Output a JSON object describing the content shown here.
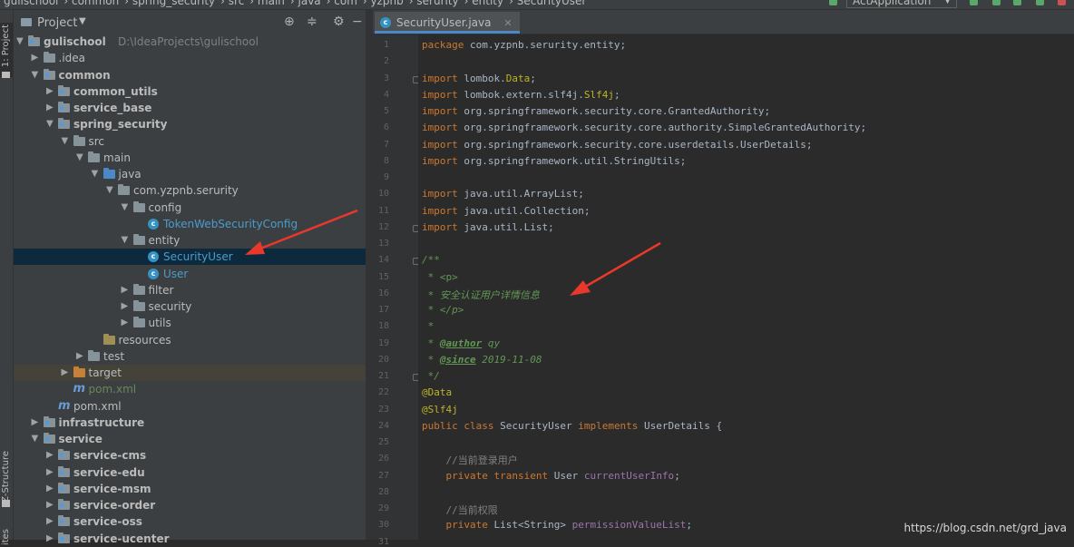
{
  "breadcrumbs": [
    "gulischool",
    "common",
    "spring_security",
    "src",
    "main",
    "java",
    "com",
    "yzpnb",
    "serurity",
    "entity",
    "SecurityUser"
  ],
  "run_config": "ActApplication",
  "left_strip": {
    "project_tab": "1: Project",
    "structure_tab": "Z-Structure",
    "favorites_tab": "ites"
  },
  "project_panel": {
    "title": "Project"
  },
  "tree": [
    {
      "label": "gulischool",
      "path": "D:\\IdeaProjects\\gulischool",
      "depth": 0,
      "arrow": "▼",
      "icon": "folder-module",
      "bold": true
    },
    {
      "label": ".idea",
      "depth": 1,
      "arrow": "▶",
      "icon": "folder"
    },
    {
      "label": "common",
      "depth": 1,
      "arrow": "▼",
      "icon": "folder-module",
      "bold": true
    },
    {
      "label": "common_utils",
      "depth": 2,
      "arrow": "▶",
      "icon": "folder-module",
      "bold": true
    },
    {
      "label": "service_base",
      "depth": 2,
      "arrow": "▶",
      "icon": "folder-module",
      "bold": true
    },
    {
      "label": "spring_security",
      "depth": 2,
      "arrow": "▼",
      "icon": "folder-module",
      "bold": true
    },
    {
      "label": "src",
      "depth": 3,
      "arrow": "▼",
      "icon": "folder"
    },
    {
      "label": "main",
      "depth": 4,
      "arrow": "▼",
      "icon": "folder"
    },
    {
      "label": "java",
      "depth": 5,
      "arrow": "▼",
      "icon": "folder-src"
    },
    {
      "label": "com.yzpnb.serurity",
      "depth": 6,
      "arrow": "▼",
      "icon": "folder"
    },
    {
      "label": "config",
      "depth": 7,
      "arrow": "▼",
      "icon": "folder"
    },
    {
      "label": "TokenWebSecurityConfig",
      "depth": 8,
      "arrow": "",
      "icon": "class",
      "color": "c"
    },
    {
      "label": "entity",
      "depth": 7,
      "arrow": "▼",
      "icon": "folder"
    },
    {
      "label": "SecurityUser",
      "depth": 8,
      "arrow": "",
      "icon": "class",
      "color": "c",
      "selected": true
    },
    {
      "label": "User",
      "depth": 8,
      "arrow": "",
      "icon": "class",
      "color": "c"
    },
    {
      "label": "filter",
      "depth": 7,
      "arrow": "▶",
      "icon": "folder"
    },
    {
      "label": "security",
      "depth": 7,
      "arrow": "▶",
      "icon": "folder"
    },
    {
      "label": "utils",
      "depth": 7,
      "arrow": "▶",
      "icon": "folder"
    },
    {
      "label": "resources",
      "depth": 5,
      "arrow": "",
      "icon": "folder-res"
    },
    {
      "label": "test",
      "depth": 4,
      "arrow": "▶",
      "icon": "folder"
    },
    {
      "label": "target",
      "depth": 3,
      "arrow": "▶",
      "icon": "folder-orange",
      "excluded": true
    },
    {
      "label": "pom.xml",
      "depth": 3,
      "arrow": "",
      "icon": "maven",
      "color": "pom"
    },
    {
      "label": "pom.xml",
      "depth": 2,
      "arrow": "",
      "icon": "maven"
    },
    {
      "label": "infrastructure",
      "depth": 1,
      "arrow": "▶",
      "icon": "folder-module",
      "bold": true
    },
    {
      "label": "service",
      "depth": 1,
      "arrow": "▼",
      "icon": "folder-module",
      "bold": true
    },
    {
      "label": "service-cms",
      "depth": 2,
      "arrow": "▶",
      "icon": "folder-module",
      "bold": true
    },
    {
      "label": "service-edu",
      "depth": 2,
      "arrow": "▶",
      "icon": "folder-module",
      "bold": true
    },
    {
      "label": "service-msm",
      "depth": 2,
      "arrow": "▶",
      "icon": "folder-module",
      "bold": true
    },
    {
      "label": "service-order",
      "depth": 2,
      "arrow": "▶",
      "icon": "folder-module",
      "bold": true
    },
    {
      "label": "service-oss",
      "depth": 2,
      "arrow": "▶",
      "icon": "folder-module",
      "bold": true
    },
    {
      "label": "service-ucenter",
      "depth": 2,
      "arrow": "▶",
      "icon": "folder-module",
      "bold": true
    }
  ],
  "editor": {
    "tab_title": "SecurityUser.java",
    "lines": [
      {
        "n": "1",
        "html": "<span class=\"kw\">package</span> com.yzpnb.serurity.entity;"
      },
      {
        "n": "2",
        "html": ""
      },
      {
        "n": "3",
        "html": "<span class=\"kw\">import</span> lombok.<span class=\"an\">Data</span>;",
        "fold": true
      },
      {
        "n": "4",
        "html": "<span class=\"kw\">import</span> lombok.extern.slf4j.<span class=\"an\">Slf4j</span>;"
      },
      {
        "n": "5",
        "html": "<span class=\"kw\">import</span> org.springframework.security.core.GrantedAuthority;"
      },
      {
        "n": "6",
        "html": "<span class=\"kw\">import</span> org.springframework.security.core.authority.SimpleGrantedAuthority;"
      },
      {
        "n": "7",
        "html": "<span class=\"kw\">import</span> org.springframework.security.core.userdetails.UserDetails;"
      },
      {
        "n": "8",
        "html": "<span class=\"kw\">import</span> org.springframework.util.StringUtils;"
      },
      {
        "n": "9",
        "html": ""
      },
      {
        "n": "10",
        "html": "<span class=\"kw\">import</span> java.util.ArrayList;"
      },
      {
        "n": "11",
        "html": "<span class=\"kw\">import</span> java.util.Collection;"
      },
      {
        "n": "12",
        "html": "<span class=\"kw\">import</span> java.util.List;",
        "fold": true
      },
      {
        "n": "13",
        "html": ""
      },
      {
        "n": "14",
        "html": "<span class=\"cm\">/**</span>",
        "fold": true
      },
      {
        "n": "15",
        "html": "<span class=\"cm\"> * </span><span class=\"cm\" style=\"font-style:normal\">&lt;p&gt;</span>"
      },
      {
        "n": "16",
        "html": "<span class=\"cm\"> * 安全认证用户详情信息</span>"
      },
      {
        "n": "17",
        "html": "<span class=\"cm\"> * &lt;/p&gt;</span>"
      },
      {
        "n": "18",
        "html": "<span class=\"cm\"> *</span>"
      },
      {
        "n": "19",
        "html": "<span class=\"cm\"> * </span><span class=\"tag\">@author</span><span class=\"cm\"> qy</span>"
      },
      {
        "n": "20",
        "html": "<span class=\"cm\"> * </span><span class=\"tag\">@since</span><span class=\"cm\"> 2019-11-08</span>"
      },
      {
        "n": "21",
        "html": "<span class=\"cm\"> */</span>",
        "fold": true
      },
      {
        "n": "22",
        "html": "<span class=\"an\">@Data</span>"
      },
      {
        "n": "23",
        "html": "<span class=\"an\">@Slf4j</span>"
      },
      {
        "n": "24",
        "html": "<span class=\"kw\">public class</span> SecurityUser <span class=\"kw\">implements</span> UserDetails {"
      },
      {
        "n": "25",
        "html": ""
      },
      {
        "n": "26",
        "html": "    <span class=\"cmt\">//当前登录用户</span>"
      },
      {
        "n": "27",
        "html": "    <span class=\"kw\">private transient</span> User <span class=\"fld\">currentUserInfo</span>;"
      },
      {
        "n": "28",
        "html": ""
      },
      {
        "n": "29",
        "html": "    <span class=\"cmt\">//当前权限</span>"
      },
      {
        "n": "30",
        "html": "    <span class=\"kw\">private</span> List&lt;String&gt; <span class=\"fld\">permissionValueList</span>;"
      },
      {
        "n": "31",
        "html": ""
      }
    ]
  },
  "watermark": "https://blog.csdn.net/grd_java",
  "colors": {
    "annotation_arrow": "#e8382c",
    "selection": "#0d293e",
    "accent": "#4a88c7"
  }
}
